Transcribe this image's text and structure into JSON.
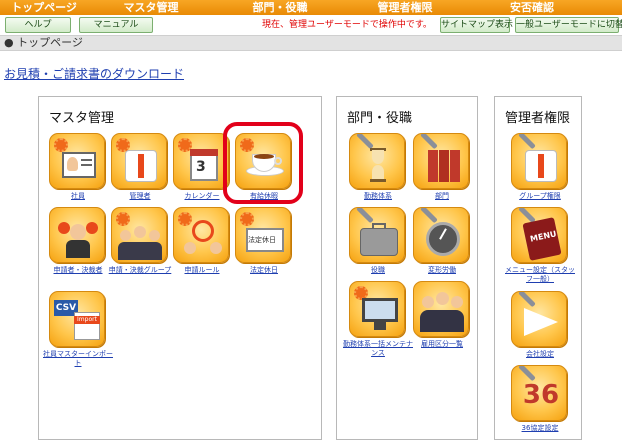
{
  "nav": [
    "トップページ",
    "マスタ管理",
    "部門・役職",
    "管理者権限",
    "安否確認"
  ],
  "buttons": {
    "help": "ヘルプ",
    "manual": "マニュアル",
    "sitemap": "サイトマップ表示",
    "switch_mode": "一般ユーザーモードに切替"
  },
  "mode_notice": "現在、管理ユーザーモードで操作中です。",
  "breadcrumb": "● トップページ",
  "download_link": "お見積・ご請求書のダウンロード",
  "panels": {
    "master": {
      "title": "マスタ管理",
      "tiles": [
        {
          "label": "社員",
          "icon": "employee-card-icon"
        },
        {
          "label": "管理者",
          "icon": "manager-shirt-icon"
        },
        {
          "label": "カレンダー",
          "icon": "calendar-icon"
        },
        {
          "label": "有給休暇",
          "icon": "coffee-cup-icon"
        },
        {
          "label": "申請者・決裁者",
          "icon": "applicant-approver-icon"
        },
        {
          "label": "申請・決裁グループ",
          "icon": "group-icon"
        },
        {
          "label": "申請ルール",
          "icon": "rule-icon"
        },
        {
          "label": "法定休日",
          "icon": "legal-holiday-icon"
        },
        {
          "label": "社員マスターインポート",
          "icon": "csv-import-icon"
        }
      ]
    },
    "dept": {
      "title": "部門・役職",
      "tiles": [
        {
          "label": "勤務体系",
          "icon": "hourglass-icon"
        },
        {
          "label": "部門",
          "icon": "binders-icon"
        },
        {
          "label": "役職",
          "icon": "briefcase-icon"
        },
        {
          "label": "変形労働",
          "icon": "gauge-icon"
        },
        {
          "label": "勤務体系一括メンテナンス",
          "icon": "monitor-icon"
        },
        {
          "label": "雇用区分一覧",
          "icon": "people-group-icon"
        }
      ]
    },
    "admin": {
      "title": "管理者権限",
      "tiles": [
        {
          "label": "グループ権限",
          "icon": "group-permission-icon"
        },
        {
          "label": "メニュー設定（スタッフ一般）",
          "icon": "menu-book-icon"
        },
        {
          "label": "会社設定",
          "icon": "paper-plane-icon"
        },
        {
          "label": "36協定設定",
          "icon": "36-agreement-icon"
        }
      ]
    }
  },
  "tile_text": {
    "calendar": "3",
    "legal_holiday": "法定休日",
    "csv": "CSV",
    "import": "Import",
    "menu": "MENU",
    "thirtysix": "36"
  },
  "colors": {
    "nav": "#f09a12",
    "highlight": "#e2001a",
    "link": "#1f3fb0",
    "notice": "#e00000"
  }
}
